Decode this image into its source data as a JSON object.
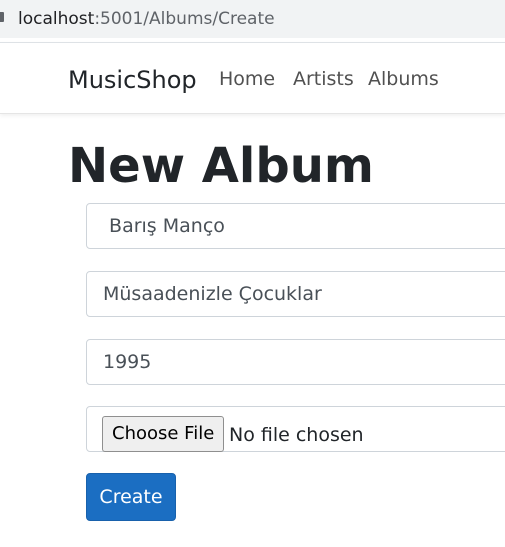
{
  "browser": {
    "url_host": "localhost",
    "url_path": ":5001/Albums/Create"
  },
  "navbar": {
    "brand": "MusicShop",
    "links": [
      "Home",
      "Artists",
      "Albums"
    ]
  },
  "page": {
    "title": "New Album"
  },
  "form": {
    "artist_value": " Barış Manço",
    "album_name_value": "Müsaadenizle Çocuklar",
    "year_value": "1995",
    "file_button_label": "Choose File",
    "file_status": "No file chosen",
    "submit_label": "Create"
  },
  "colors": {
    "primary": "#1b6ec2",
    "text": "#212529",
    "nav_text": "#515151",
    "border": "#ced4da"
  }
}
